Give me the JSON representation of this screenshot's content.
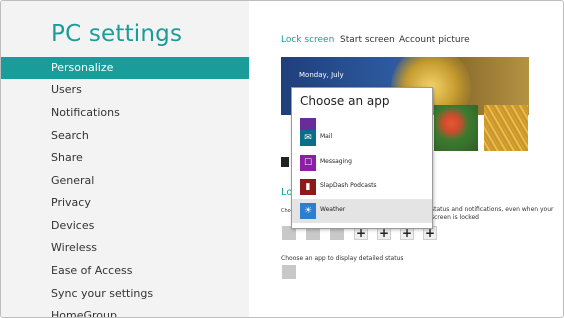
{
  "sidebar": {
    "title": "PC settings",
    "items": [
      {
        "label": "Personalize",
        "active": true
      },
      {
        "label": "Users"
      },
      {
        "label": "Notifications"
      },
      {
        "label": "Search"
      },
      {
        "label": "Share"
      },
      {
        "label": "General"
      },
      {
        "label": "Privacy"
      },
      {
        "label": "Devices"
      },
      {
        "label": "Wireless"
      },
      {
        "label": "Ease of Access"
      },
      {
        "label": "Sync your settings"
      },
      {
        "label": "HomeGroup"
      }
    ]
  },
  "tabs": [
    {
      "label": "Lock screen",
      "active": true
    },
    {
      "label": "Start screen"
    },
    {
      "label": "Account picture"
    }
  ],
  "lock_preview": {
    "time": "",
    "date": "Monday, July"
  },
  "lock_apps": {
    "heading": "Lo",
    "desc_left": "Cho",
    "desc_right": "status and notifications, even when your screen is locked"
  },
  "detailed_status": {
    "text": "Choose an app to display detailed status"
  },
  "popup": {
    "title": "Choose an app",
    "apps": [
      {
        "label": "",
        "color": "#6a2c9a"
      },
      {
        "label": "Mail",
        "color": "#0a6e86"
      },
      {
        "label": "Messaging",
        "color": "#8b1fa6"
      },
      {
        "label": "SlapDash Podcasts",
        "color": "#8c1a1a"
      },
      {
        "label": "Weather",
        "color": "#2c7fcf",
        "selected": true
      }
    ]
  },
  "colors": {
    "accent": "#1a9c9a"
  }
}
